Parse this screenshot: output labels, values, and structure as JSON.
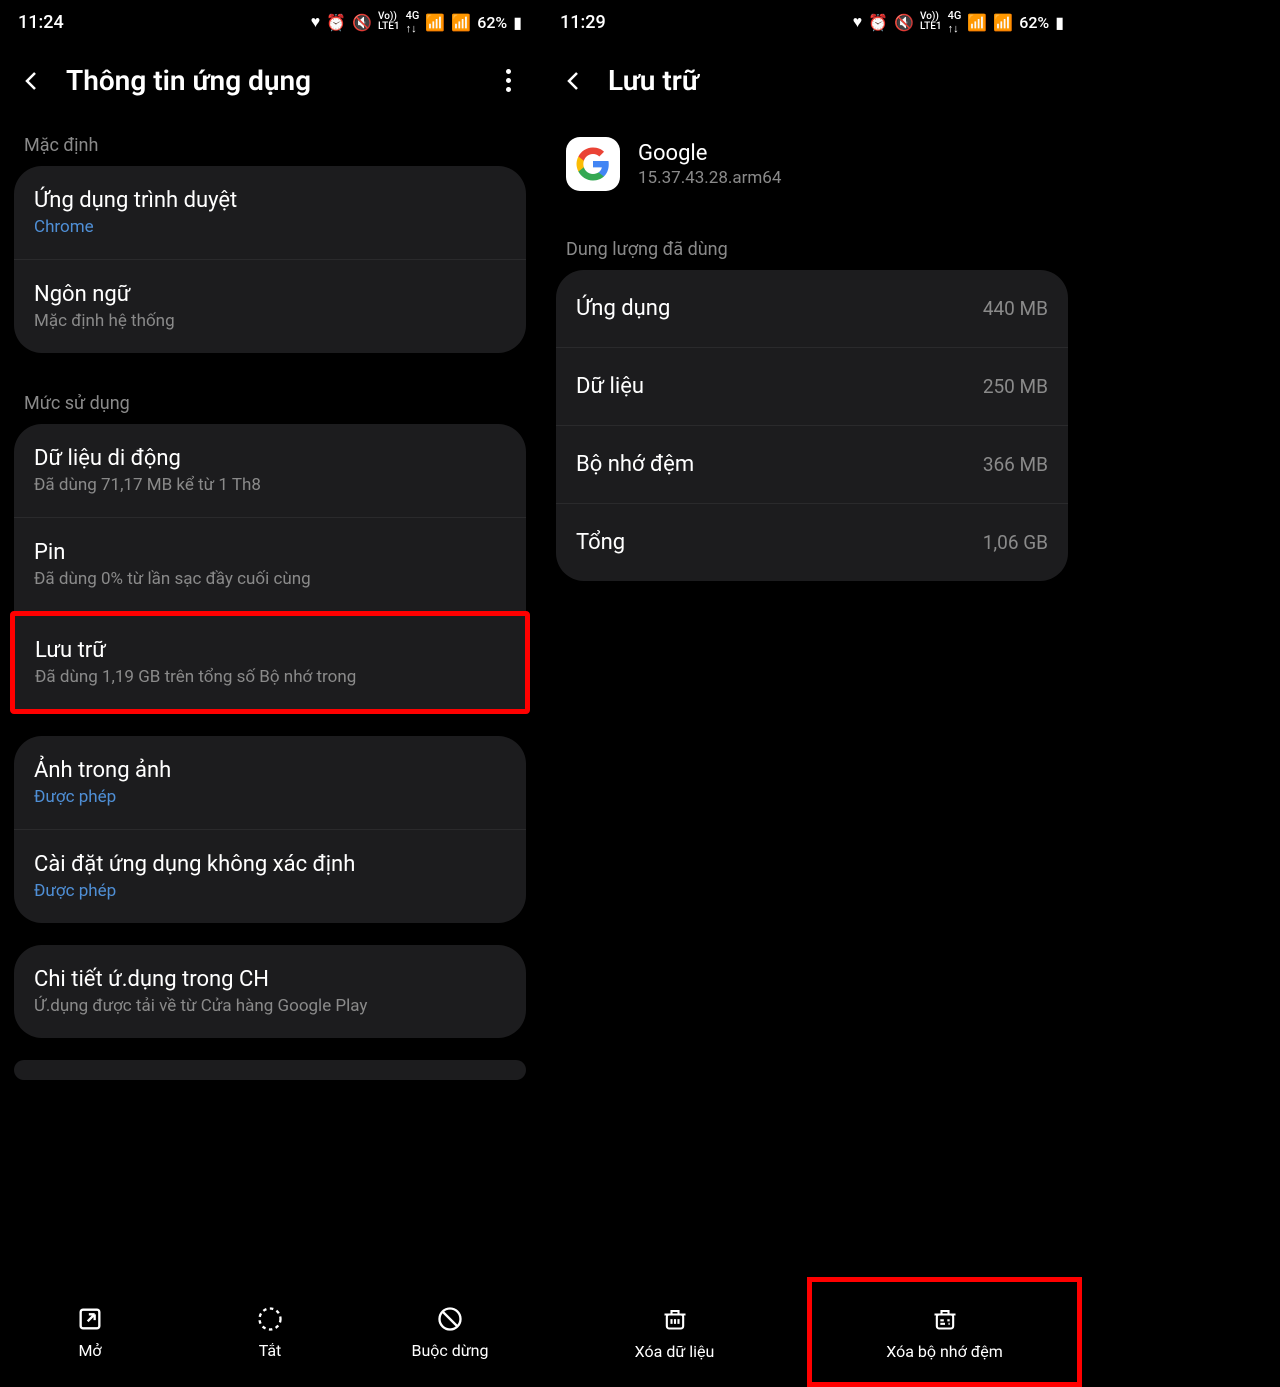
{
  "left": {
    "status": {
      "time": "11:24",
      "battery": "62%"
    },
    "header": {
      "title": "Thông tin ứng dụng"
    },
    "section1": {
      "label": "Mặc định",
      "items": [
        {
          "title": "Ứng dụng trình duyệt",
          "sub": "Chrome",
          "link": true
        },
        {
          "title": "Ngôn ngữ",
          "sub": "Mặc định hệ thống"
        }
      ]
    },
    "section2": {
      "label": "Mức sử dụng",
      "items": [
        {
          "title": "Dữ liệu di động",
          "sub": "Đã dùng 71,17 MB kể từ 1 Th8"
        },
        {
          "title": "Pin",
          "sub": "Đã dùng 0% từ lần sạc đầy cuối cùng"
        },
        {
          "title": "Lưu trữ",
          "sub": "Đã dùng 1,19 GB trên tổng số Bộ nhớ trong",
          "highlight": true
        }
      ]
    },
    "section3": {
      "items": [
        {
          "title": "Ảnh trong ảnh",
          "sub": "Được phép",
          "link": true
        },
        {
          "title": "Cài đặt ứng dụng không xác định",
          "sub": "Được phép",
          "link": true
        }
      ]
    },
    "section4": {
      "items": [
        {
          "title": "Chi tiết ứ.dụng trong CH",
          "sub": "Ứ.dụng được tải về từ Cửa hàng Google Play"
        }
      ]
    },
    "bottom": [
      {
        "icon": "open",
        "label": "Mở"
      },
      {
        "icon": "disable",
        "label": "Tắt"
      },
      {
        "icon": "stop",
        "label": "Buộc dừng"
      }
    ]
  },
  "right": {
    "status": {
      "time": "11:29",
      "battery": "62%"
    },
    "header": {
      "title": "Lưu trữ"
    },
    "app": {
      "name": "Google",
      "version": "15.37.43.28.arm64"
    },
    "usage_label": "Dung lượng đã dùng",
    "rows": [
      {
        "label": "Ứng dụng",
        "value": "440 MB"
      },
      {
        "label": "Dữ liệu",
        "value": "250 MB"
      },
      {
        "label": "Bộ nhớ đệm",
        "value": "366 MB"
      },
      {
        "label": "Tổng",
        "value": "1,06 GB"
      }
    ],
    "bottom": [
      {
        "label": "Xóa dữ liệu"
      },
      {
        "label": "Xóa bộ nhớ đệm",
        "highlight": true
      }
    ]
  }
}
